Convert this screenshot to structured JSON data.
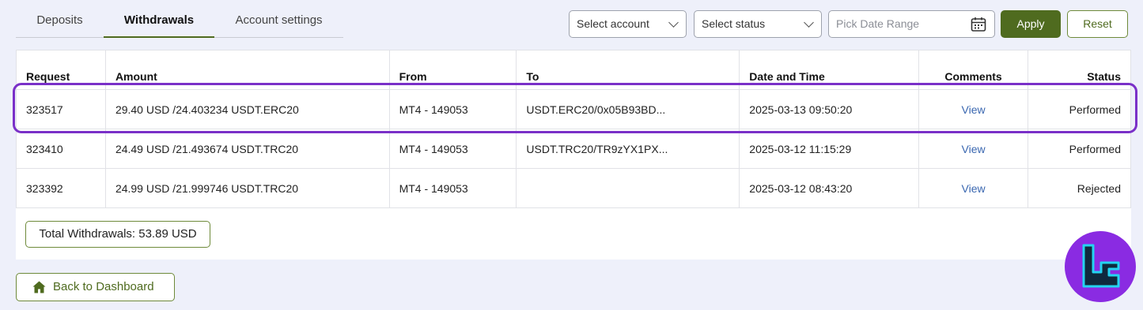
{
  "tabs": [
    {
      "label": "Deposits"
    },
    {
      "label": "Withdrawals"
    },
    {
      "label": "Account settings"
    }
  ],
  "filters": {
    "account_placeholder": "Select account",
    "status_placeholder": "Select status",
    "date_placeholder": "Pick Date Range",
    "apply_label": "Apply",
    "reset_label": "Reset"
  },
  "table": {
    "headers": {
      "request": "Request",
      "amount": "Amount",
      "from": "From",
      "to": "To",
      "datetime": "Date and Time",
      "comments": "Comments",
      "status": "Status"
    },
    "rows": [
      {
        "request": "323517",
        "amount": "29.40 USD /24.403234 USDT.ERC20",
        "from": "MT4 - 149053",
        "to": "USDT.ERC20/0x05B93BD...",
        "datetime": "2025-03-13 09:50:20",
        "comments": "View",
        "status": "Performed"
      },
      {
        "request": "323410",
        "amount": "24.49 USD /21.493674 USDT.TRC20",
        "from": "MT4 - 149053",
        "to": "USDT.TRC20/TR9zYX1PX...",
        "datetime": "2025-03-12 11:15:29",
        "comments": "View",
        "status": "Performed"
      },
      {
        "request": "323392",
        "amount": "24.99 USD /21.999746 USDT.TRC20",
        "from": "MT4 - 149053",
        "to": "",
        "datetime": "2025-03-12 08:43:20",
        "comments": "View",
        "status": "Rejected"
      }
    ]
  },
  "summary": {
    "total_label": "Total Withdrawals: 53.89 USD"
  },
  "footer": {
    "back_label": "Back to Dashboard"
  },
  "colors": {
    "accent": "#4f6b1f",
    "highlight": "#7a30c8",
    "logo_bg": "#8a2be2",
    "logo_fg": "#23d4f0"
  },
  "icons": {
    "calendar": "calendar-icon",
    "home": "home-icon",
    "chevron": "chevron-down-icon"
  }
}
